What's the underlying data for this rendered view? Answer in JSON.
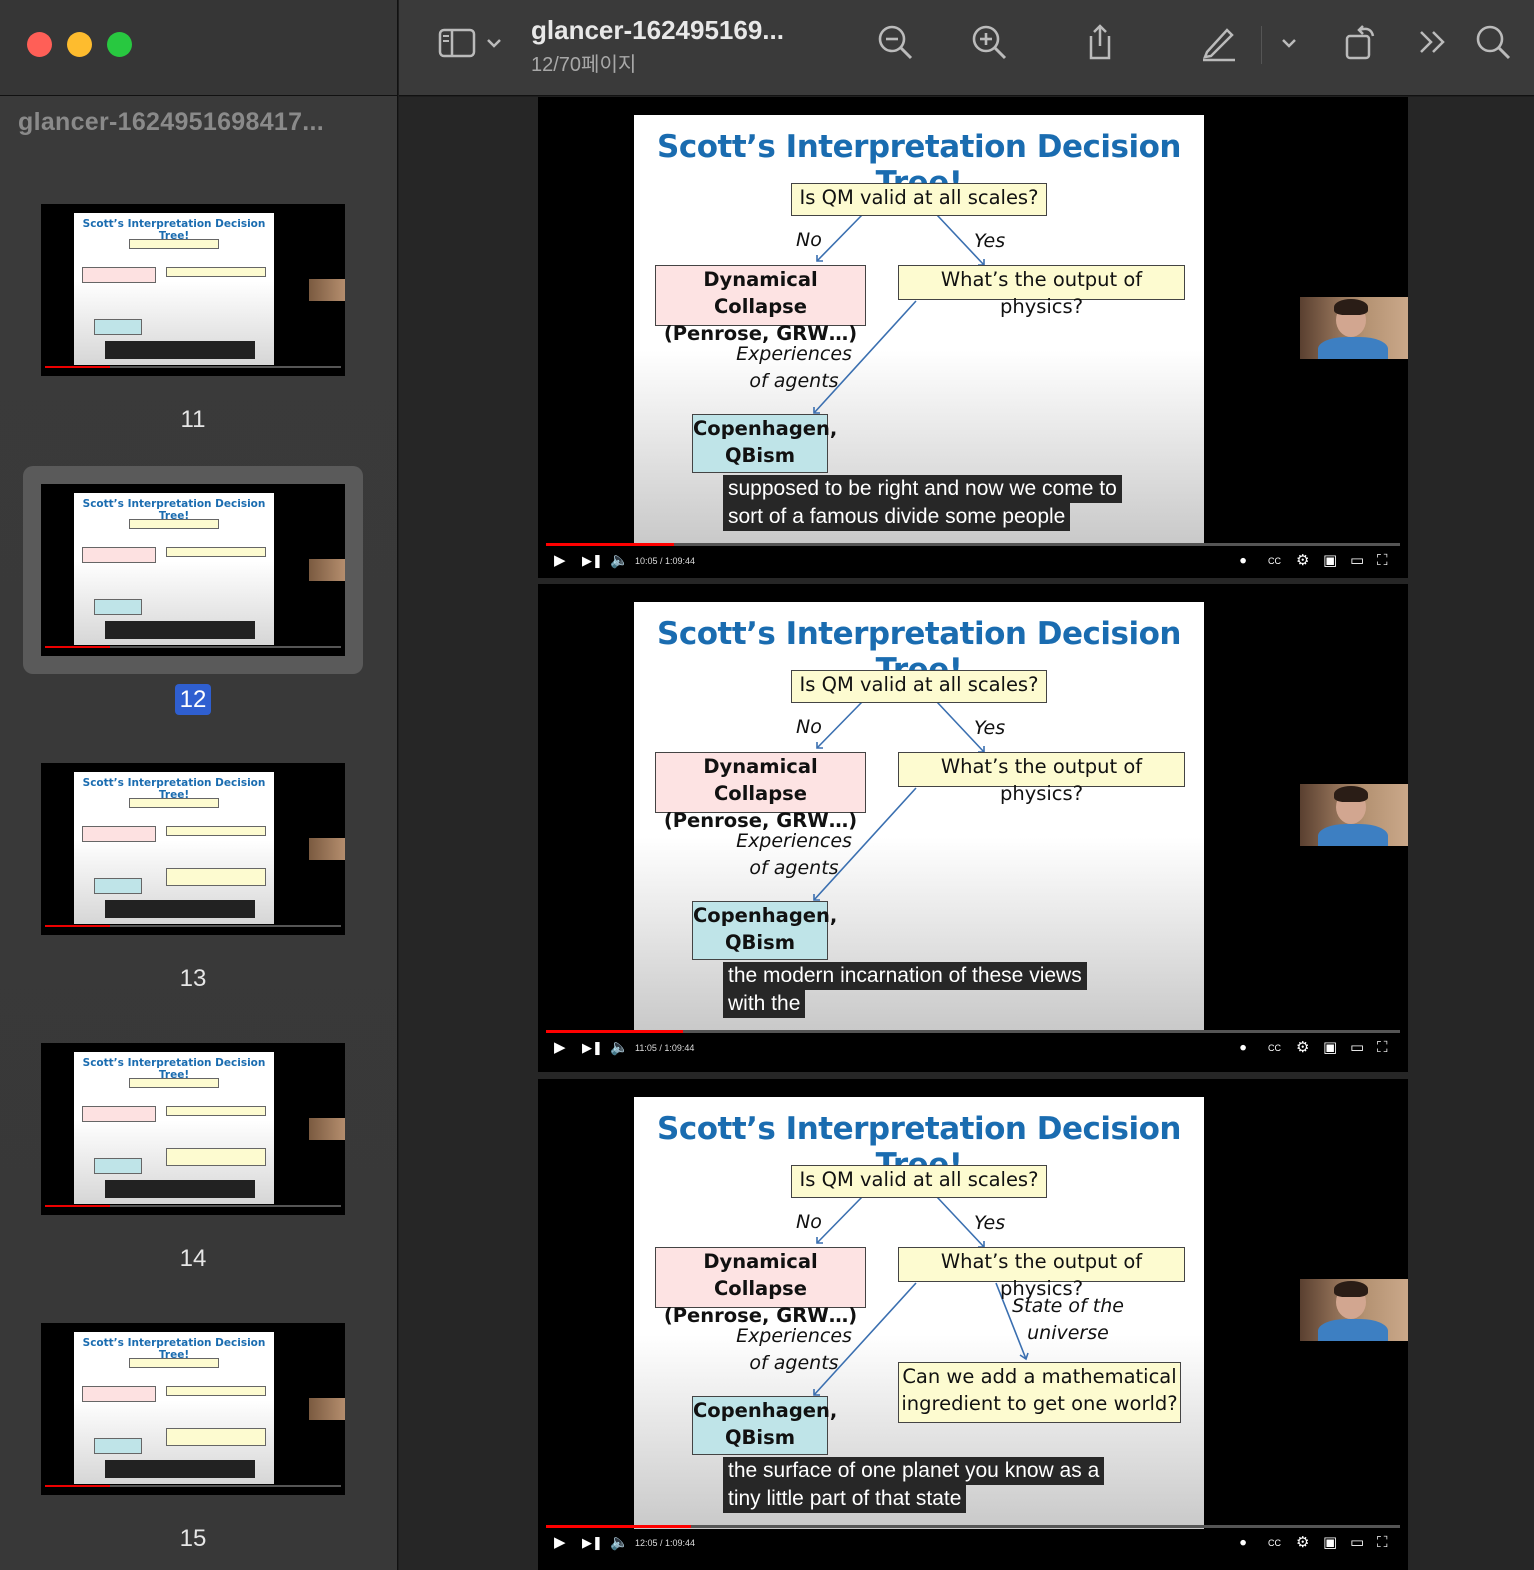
{
  "window": {
    "sidebar_title": "glancer-1624951698417...",
    "doc_title": "glancer-162495169...",
    "page_indicator": "12/70페이지"
  },
  "toolbar_icons": [
    "sidebar-toggle-icon",
    "chevron-down-icon",
    "zoom-out-icon",
    "zoom-in-icon",
    "share-icon",
    "markup-pen-icon",
    "chevron-down-icon",
    "rotate-icon",
    "more-chevrons-icon",
    "search-icon"
  ],
  "slide_text": {
    "title": "Scott’s Interpretation Decision Tree!",
    "q1": "Is QM valid at all scales?",
    "no": "No",
    "yes": "Yes",
    "dyn1": "Dynamical Collapse",
    "dyn2": "(Penrose, GRW…)",
    "out": "What’s the output of physics?",
    "exp1": "Experiences",
    "exp2": "of agents",
    "cop1": "Copenhagen,",
    "cop2": "QBism",
    "state1": "State of the",
    "state2": "universe",
    "math1": "Can we add a mathematical",
    "math2": "ingredient to get one world?"
  },
  "thumbnails": [
    {
      "page": "11",
      "selected": false
    },
    {
      "page": "12",
      "selected": true
    },
    {
      "page": "13",
      "selected": false
    },
    {
      "page": "14",
      "selected": false
    },
    {
      "page": "15",
      "selected": false
    }
  ],
  "pages": [
    {
      "caption1": "supposed to be right and now we come to",
      "caption2": "sort of a famous divide some people",
      "time": "10:05 / 1:09:44",
      "progress": 0.15
    },
    {
      "caption1": "the modern incarnation of these views",
      "caption2": "with the",
      "time": "11:05 / 1:09:44",
      "progress": 0.16
    },
    {
      "caption1": "the surface of one planet you know as a",
      "caption2": "tiny little part of that state",
      "time": "12:05 / 1:09:44",
      "progress": 0.17
    }
  ],
  "colors": {
    "slide_title": "#1a6cb0",
    "selected_page": "#2f5fd0",
    "progress": "#ff0000"
  }
}
